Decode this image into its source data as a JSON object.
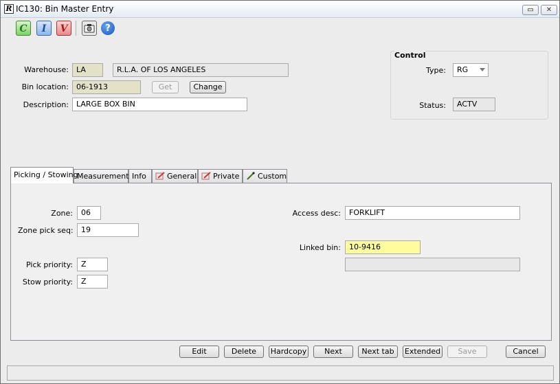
{
  "window": {
    "title": "IC130: Bin Master Entry",
    "app_icon_glyph": "R",
    "restore_glyph": "▭",
    "close_glyph": "✕"
  },
  "toolbar": {
    "buttons": [
      {
        "name": "c",
        "glyph": "C",
        "color": "#2e8b2e"
      },
      {
        "name": "i",
        "glyph": "I",
        "color": "#2060c0"
      },
      {
        "name": "v",
        "glyph": "V",
        "color": "#c02020"
      },
      {
        "name": "camera",
        "glyph": "📷"
      },
      {
        "name": "help",
        "glyph": "?"
      }
    ]
  },
  "header": {
    "warehouse_label": "Warehouse:",
    "warehouse_code": "LA",
    "warehouse_name": "R.L.A. OF LOS ANGELES",
    "bin_location_label": "Bin location:",
    "bin_location_value": "06-1913",
    "get_label": "Get",
    "change_label": "Change",
    "description_label": "Description:",
    "description_value": "LARGE BOX BIN"
  },
  "control": {
    "title": "Control",
    "type_label": "Type:",
    "type_value": "RG",
    "status_label": "Status:",
    "status_value": "ACTV"
  },
  "tabs": [
    {
      "label": "Picking / Stowing",
      "active": true
    },
    {
      "label": "Measurements"
    },
    {
      "label": "Info"
    },
    {
      "label": "General",
      "icon": "edit-icon"
    },
    {
      "label": "Private",
      "icon": "edit-icon"
    },
    {
      "label": "Custom",
      "icon": "pen-icon"
    }
  ],
  "picking": {
    "zone_label": "Zone:",
    "zone_value": "06",
    "zone_pick_seq_label": "Zone pick seq:",
    "zone_pick_seq_value": "19",
    "pick_priority_label": "Pick priority:",
    "pick_priority_value": "Z",
    "stow_priority_label": "Stow priority:",
    "stow_priority_value": "Z",
    "access_desc_label": "Access desc:",
    "access_desc_value": "FORKLIFT",
    "linked_bin_label": "Linked bin:",
    "linked_bin_value": "10-9416",
    "linked_bin_desc": ""
  },
  "actions": {
    "edit": "Edit",
    "delete": "Delete",
    "hardcopy": "Hardcopy",
    "next": "Next",
    "next_tab": "Next tab",
    "extended": "Extended",
    "save": "Save",
    "cancel": "Cancel"
  },
  "status_bar": {
    "text": ""
  }
}
